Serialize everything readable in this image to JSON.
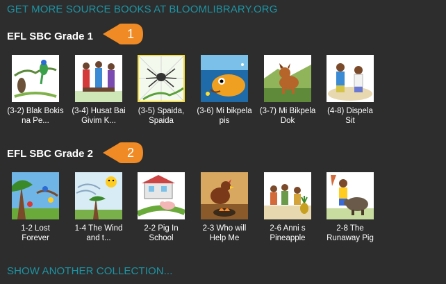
{
  "header": {
    "more_books_link": "GET MORE SOURCE BOOKS AT BLOOMLIBRARY.ORG"
  },
  "collections": [
    {
      "title": "EFL SBC Grade 1",
      "callout": "1",
      "books": [
        {
          "title": "(3-2) Blak Bokis na Pe...",
          "selected": false
        },
        {
          "title": "(3-4) Husat Bai Givim K...",
          "selected": false
        },
        {
          "title": "(3-5) Spaida, Spaida",
          "selected": true
        },
        {
          "title": "(3-6) Mi bikpela pis",
          "selected": false
        },
        {
          "title": "(3-7) Mi Bikpela Dok",
          "selected": false
        },
        {
          "title": "(4-8) Dispela Sit",
          "selected": false
        }
      ]
    },
    {
      "title": "EFL SBC Grade 2",
      "callout": "2",
      "books": [
        {
          "title": "1-2 Lost Forever",
          "selected": false
        },
        {
          "title": "1-4 The Wind and t...",
          "selected": false
        },
        {
          "title": "2-2 Pig In School",
          "selected": false
        },
        {
          "title": "2-3 Who will Help Me",
          "selected": false
        },
        {
          "title": "2-6 Anni s Pineapple",
          "selected": false
        },
        {
          "title": "2-8 The Runaway Pig",
          "selected": false
        }
      ]
    }
  ],
  "footer": {
    "show_another_link": "SHOW ANOTHER COLLECTION..."
  },
  "colors": {
    "link": "#1d94a4",
    "callout": "#f08a24",
    "background": "#2d2d2d",
    "selected_border": "#f5dd3a"
  }
}
